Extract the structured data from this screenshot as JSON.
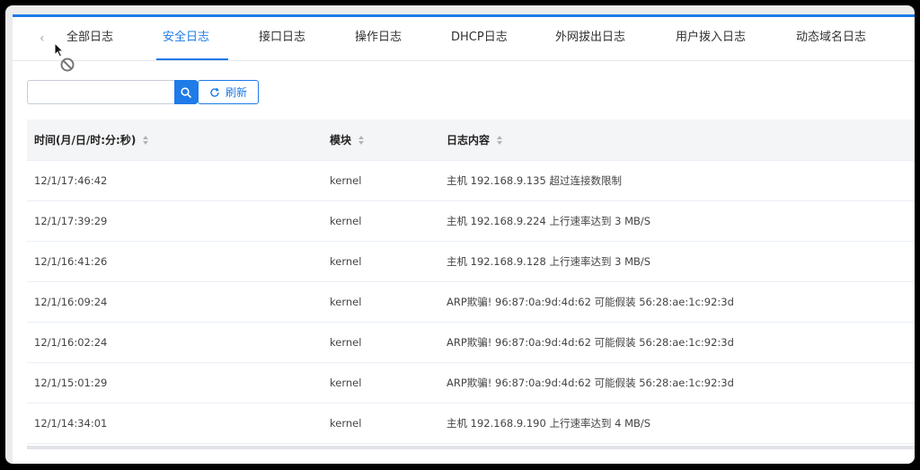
{
  "tabs": [
    {
      "label": "全部日志",
      "active": false
    },
    {
      "label": "安全日志",
      "active": true
    },
    {
      "label": "接口日志",
      "active": false
    },
    {
      "label": "操作日志",
      "active": false
    },
    {
      "label": "DHCP日志",
      "active": false
    },
    {
      "label": "外网拔出日志",
      "active": false
    },
    {
      "label": "用户拨入日志",
      "active": false
    },
    {
      "label": "动态域名日志",
      "active": false
    }
  ],
  "toolbar": {
    "search_value": "",
    "refresh_label": "刷新"
  },
  "colors": {
    "accent": "#1e7be8",
    "header_bg": "#f4f5f7"
  },
  "table": {
    "columns": [
      "时间(月/日/时:分:秒)",
      "模块",
      "日志内容"
    ],
    "rows": [
      [
        "12/1/17:46:42",
        "kernel",
        "主机 192.168.9.135 超过连接数限制"
      ],
      [
        "12/1/17:39:29",
        "kernel",
        "主机 192.168.9.224 上行速率达到 3 MB/S"
      ],
      [
        "12/1/16:41:26",
        "kernel",
        "主机 192.168.9.128 上行速率达到 3 MB/S"
      ],
      [
        "12/1/16:09:24",
        "kernel",
        "ARP欺骗! 96:87:0a:9d:4d:62 可能假装 56:28:ae:1c:92:3d"
      ],
      [
        "12/1/16:02:24",
        "kernel",
        "ARP欺骗! 96:87:0a:9d:4d:62 可能假装 56:28:ae:1c:92:3d"
      ],
      [
        "12/1/15:01:29",
        "kernel",
        "ARP欺骗! 96:87:0a:9d:4d:62 可能假装 56:28:ae:1c:92:3d"
      ],
      [
        "12/1/14:34:01",
        "kernel",
        "主机 192.168.9.190 上行速率达到 4 MB/S"
      ]
    ]
  }
}
